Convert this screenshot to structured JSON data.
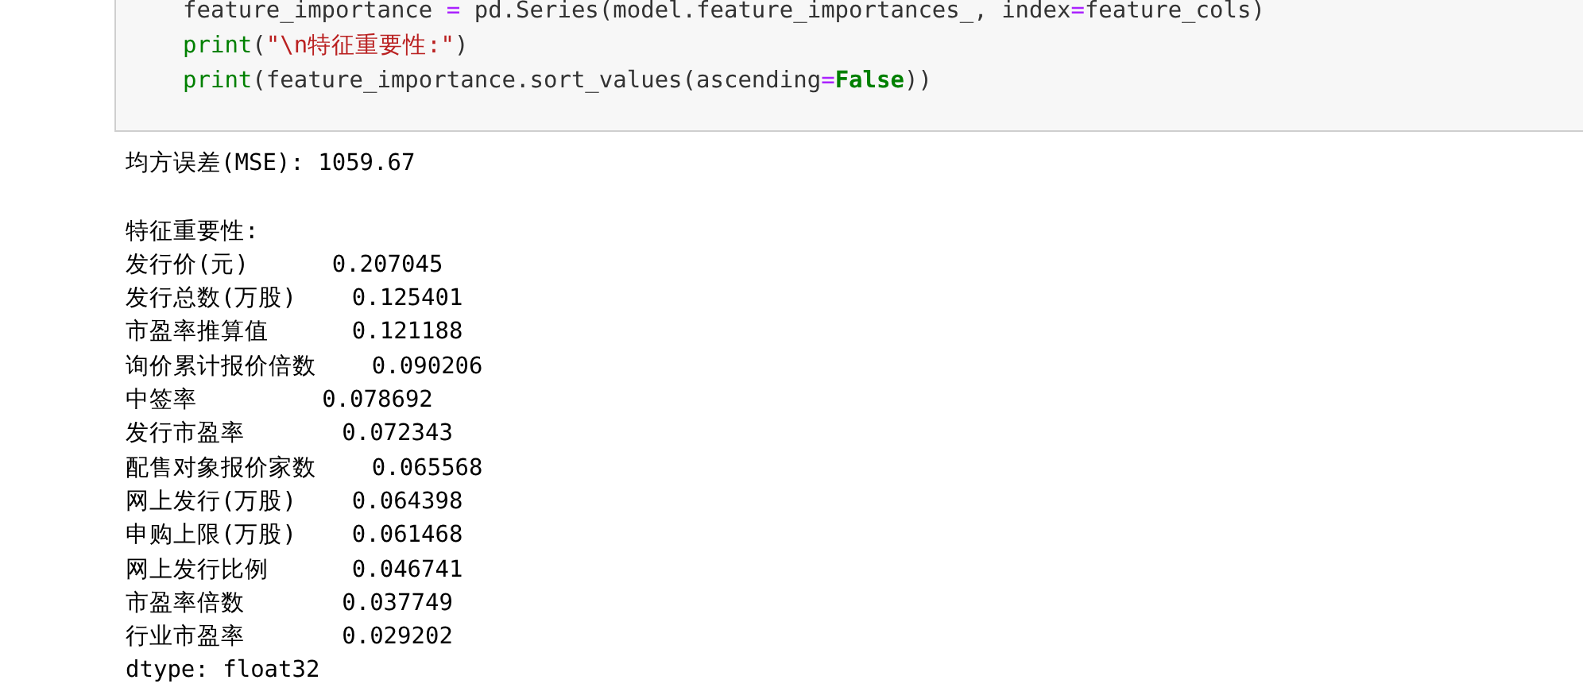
{
  "code_cell": {
    "lines": [
      [
        {
          "kind": "name",
          "text": "feature_importance "
        },
        {
          "kind": "operator",
          "text": "="
        },
        {
          "kind": "name",
          "text": " pd.Series(model.feature_importances_, index"
        },
        {
          "kind": "operator",
          "text": "="
        },
        {
          "kind": "name",
          "text": "feature_cols)"
        }
      ],
      [
        {
          "kind": "builtin",
          "text": "print"
        },
        {
          "kind": "name",
          "text": "("
        },
        {
          "kind": "string",
          "text": "\"\\n特征重要性:\""
        },
        {
          "kind": "name",
          "text": ")"
        }
      ],
      [
        {
          "kind": "builtin",
          "text": "print"
        },
        {
          "kind": "name",
          "text": "(feature_importance.sort_values(ascending"
        },
        {
          "kind": "operator",
          "text": "="
        },
        {
          "kind": "keyword",
          "text": "False"
        },
        {
          "kind": "name",
          "text": "))"
        }
      ]
    ]
  },
  "output": {
    "summary": "均方误差(MSE): 1059.67",
    "lines": [
      "特征重要性:",
      "发行价(元)      0.207045",
      "发行总数(万股)    0.125401",
      "市盈率推算值      0.121188",
      "询价累计报价倍数    0.090206",
      "中签率         0.078692",
      "发行市盈率       0.072343",
      "配售对象报价家数    0.065568",
      "网上发行(万股)    0.064398",
      "申购上限(万股)    0.061468",
      "网上发行比例      0.046741",
      "市盈率倍数       0.037749",
      "行业市盈率       0.029202",
      "dtype: float32"
    ]
  }
}
